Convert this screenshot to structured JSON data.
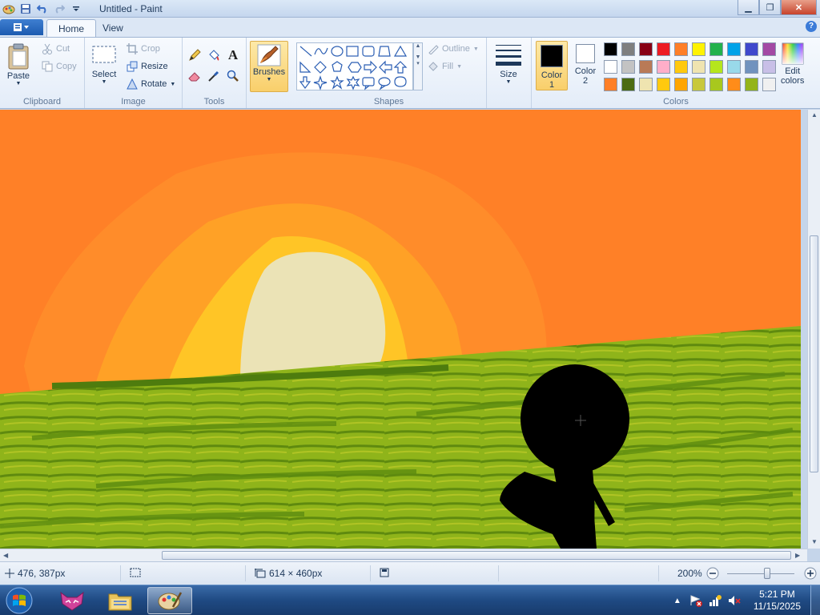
{
  "window": {
    "title": "Untitled - Paint",
    "minimize": "▁",
    "maximize": "❐",
    "close": "✕"
  },
  "tabs": {
    "home": "Home",
    "view": "View",
    "help": "?"
  },
  "clipboard": {
    "paste": "Paste",
    "cut": "Cut",
    "copy": "Copy",
    "label": "Clipboard"
  },
  "image": {
    "select": "Select",
    "crop": "Crop",
    "resize": "Resize",
    "rotate": "Rotate",
    "label": "Image"
  },
  "tools": {
    "label": "Tools",
    "text_glyph": "A"
  },
  "brushes": {
    "label": "Brushes"
  },
  "shapes": {
    "outline": "Outline",
    "fill": "Fill",
    "label": "Shapes"
  },
  "size": {
    "label": "Size"
  },
  "colors": {
    "color1_label": "Color",
    "color1_num": "1",
    "color2_label": "Color",
    "color2_num": "2",
    "edit_line1": "Edit",
    "edit_line2": "colors",
    "label": "Colors",
    "color1_value": "#000000",
    "color2_value": "#ffffff",
    "palette": [
      "#000000",
      "#7f7f7f",
      "#880015",
      "#ed1c24",
      "#ff7f27",
      "#fff200",
      "#22b14c",
      "#00a2e8",
      "#3f48cc",
      "#a349a4",
      "#ffffff",
      "#c3c3c3",
      "#b97a57",
      "#ffaec9",
      "#ffc90e",
      "#efe4b0",
      "#b5e61d",
      "#99d9ea",
      "#7092be",
      "#c8bfe7",
      "#ff7f27",
      "#4c6b12",
      "#efe4b0",
      "#ffc90e",
      "#ffa500",
      "#c8c83c",
      "#a8c81e",
      "#ff8c19",
      "#94b41a",
      "#f0f0f0"
    ]
  },
  "status": {
    "cursor_pos": "476, 387px",
    "image_size": "614 × 460px",
    "zoom": "200%",
    "zoom_level": 0.6
  },
  "taskbar": {
    "time": "5:21 PM",
    "date": "11/15/2025"
  }
}
